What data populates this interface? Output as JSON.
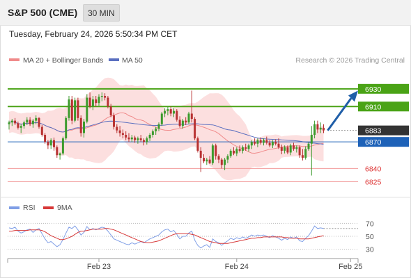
{
  "header": {
    "symbol": "S&P 500 (CME)",
    "interval": "30 MIN"
  },
  "datetime": "Tuesday, February 24, 2026 5:50:34 PM CET",
  "colors": {
    "up": "#3c9b2d",
    "down": "#b83232",
    "ma20": "#f08a8a",
    "ma50": "#5a6fc0",
    "bands": "#fcd9d9",
    "resistance": "#4aa316",
    "pivot": "#1e62b8",
    "support": "#f29b9b",
    "last": "#333333",
    "rsi": "#7f9ee6",
    "rsi_ma": "#d73838",
    "arrow": "#1f5ea8"
  },
  "chart_data": [
    {
      "type": "candlestick",
      "legend": [
        {
          "name": "MA 20 + Bollinger Bands",
          "color": "#f08a8a"
        },
        {
          "name": "MA 50",
          "color": "#5a6fc0"
        }
      ],
      "credit": "Research © 2026 Trading Central",
      "xlabels": [
        {
          "label": "Feb 23",
          "i": 30
        },
        {
          "label": "Feb 24",
          "i": 76
        },
        {
          "label": "Feb 25",
          "i": 114
        }
      ],
      "ylim": [
        6812,
        6944
      ],
      "levels": [
        {
          "label": "6930",
          "value": 6930,
          "kind": "resistance"
        },
        {
          "label": "6910",
          "value": 6910,
          "kind": "resistance"
        },
        {
          "label": "6883",
          "value": 6883,
          "kind": "last"
        },
        {
          "label": "6870",
          "value": 6870,
          "kind": "pivot"
        },
        {
          "label": "6840",
          "value": 6840,
          "kind": "support"
        },
        {
          "label": "6825",
          "value": 6825,
          "kind": "support"
        }
      ],
      "forecast": {
        "from": 6883,
        "to": 6928
      },
      "ohlc": [
        [
          6890,
          6894,
          6884,
          6892
        ],
        [
          6892,
          6896,
          6888,
          6894
        ],
        [
          6894,
          6897,
          6889,
          6891
        ],
        [
          6891,
          6893,
          6884,
          6886
        ],
        [
          6886,
          6890,
          6880,
          6888
        ],
        [
          6888,
          6894,
          6885,
          6892
        ],
        [
          6892,
          6898,
          6889,
          6895
        ],
        [
          6895,
          6898,
          6888,
          6890
        ],
        [
          6890,
          6896,
          6886,
          6894
        ],
        [
          6894,
          6900,
          6890,
          6897
        ],
        [
          6897,
          6898,
          6885,
          6887
        ],
        [
          6887,
          6889,
          6876,
          6878
        ],
        [
          6878,
          6880,
          6868,
          6870
        ],
        [
          6870,
          6872,
          6862,
          6866
        ],
        [
          6866,
          6874,
          6862,
          6872
        ],
        [
          6872,
          6875,
          6860,
          6864
        ],
        [
          6864,
          6866,
          6852,
          6855
        ],
        [
          6855,
          6858,
          6850,
          6857
        ],
        [
          6857,
          6876,
          6855,
          6874
        ],
        [
          6874,
          6899,
          6872,
          6897
        ],
        [
          6897,
          6922,
          6894,
          6918
        ],
        [
          6918,
          6922,
          6890,
          6894
        ],
        [
          6894,
          6920,
          6892,
          6917
        ],
        [
          6917,
          6920,
          6894,
          6897
        ],
        [
          6897,
          6900,
          6876,
          6880
        ],
        [
          6880,
          6896,
          6875,
          6893
        ],
        [
          6893,
          6924,
          6891,
          6920
        ],
        [
          6920,
          6926,
          6908,
          6910
        ],
        [
          6910,
          6922,
          6906,
          6918
        ],
        [
          6918,
          6922,
          6910,
          6914
        ],
        [
          6914,
          6924,
          6911,
          6921
        ],
        [
          6921,
          6926,
          6916,
          6922
        ],
        [
          6922,
          6925,
          6917,
          6920
        ],
        [
          6920,
          6922,
          6908,
          6910
        ],
        [
          6910,
          6913,
          6898,
          6900
        ],
        [
          6900,
          6903,
          6884,
          6887
        ],
        [
          6887,
          6890,
          6880,
          6883
        ],
        [
          6883,
          6888,
          6876,
          6880
        ],
        [
          6880,
          6884,
          6874,
          6878
        ],
        [
          6878,
          6882,
          6872,
          6875
        ],
        [
          6875,
          6880,
          6870,
          6873
        ],
        [
          6873,
          6878,
          6870,
          6875
        ],
        [
          6875,
          6877,
          6869,
          6872
        ],
        [
          6872,
          6876,
          6868,
          6874
        ],
        [
          6874,
          6878,
          6870,
          6872
        ],
        [
          6872,
          6874,
          6866,
          6870
        ],
        [
          6870,
          6876,
          6867,
          6874
        ],
        [
          6874,
          6880,
          6871,
          6878
        ],
        [
          6878,
          6884,
          6875,
          6882
        ],
        [
          6882,
          6887,
          6878,
          6885
        ],
        [
          6885,
          6892,
          6882,
          6890
        ],
        [
          6890,
          6904,
          6888,
          6902
        ],
        [
          6902,
          6908,
          6898,
          6905
        ],
        [
          6905,
          6910,
          6900,
          6907
        ],
        [
          6907,
          6910,
          6899,
          6902
        ],
        [
          6902,
          6908,
          6898,
          6905
        ],
        [
          6905,
          6907,
          6893,
          6895
        ],
        [
          6895,
          6899,
          6886,
          6888
        ],
        [
          6888,
          6896,
          6885,
          6894
        ],
        [
          6894,
          6898,
          6889,
          6892
        ],
        [
          6892,
          6904,
          6890,
          6902
        ],
        [
          6902,
          6928,
          6892,
          6896
        ],
        [
          6896,
          6898,
          6872,
          6874
        ],
        [
          6874,
          6876,
          6858,
          6860
        ],
        [
          6860,
          6864,
          6836,
          6852
        ],
        [
          6852,
          6856,
          6846,
          6848
        ],
        [
          6848,
          6852,
          6844,
          6850
        ],
        [
          6850,
          6854,
          6845,
          6846
        ],
        [
          6846,
          6868,
          6844,
          6866
        ],
        [
          6866,
          6868,
          6850,
          6854
        ],
        [
          6854,
          6856,
          6846,
          6850
        ],
        [
          6850,
          6852,
          6840,
          6844
        ],
        [
          6844,
          6852,
          6838,
          6850
        ],
        [
          6850,
          6856,
          6846,
          6854
        ],
        [
          6854,
          6862,
          6852,
          6860
        ],
        [
          6860,
          6864,
          6855,
          6857
        ],
        [
          6857,
          6864,
          6854,
          6862
        ],
        [
          6862,
          6866,
          6858,
          6860
        ],
        [
          6860,
          6866,
          6857,
          6864
        ],
        [
          6864,
          6868,
          6860,
          6862
        ],
        [
          6862,
          6868,
          6859,
          6866
        ],
        [
          6866,
          6872,
          6862,
          6870
        ],
        [
          6870,
          6874,
          6866,
          6868
        ],
        [
          6868,
          6874,
          6864,
          6872
        ],
        [
          6872,
          6875,
          6867,
          6869
        ],
        [
          6869,
          6874,
          6866,
          6872
        ],
        [
          6872,
          6876,
          6867,
          6869
        ],
        [
          6869,
          6872,
          6864,
          6866
        ],
        [
          6866,
          6872,
          6863,
          6870
        ],
        [
          6870,
          6873,
          6866,
          6868
        ],
        [
          6868,
          6874,
          6862,
          6864
        ],
        [
          6864,
          6867,
          6856,
          6860
        ],
        [
          6860,
          6866,
          6857,
          6864
        ],
        [
          6864,
          6866,
          6856,
          6858
        ],
        [
          6858,
          6868,
          6855,
          6866
        ],
        [
          6866,
          6869,
          6860,
          6862
        ],
        [
          6862,
          6866,
          6858,
          6864
        ],
        [
          6864,
          6866,
          6852,
          6855
        ],
        [
          6855,
          6862,
          6849,
          6852
        ],
        [
          6852,
          6865,
          6850,
          6862
        ],
        [
          6862,
          6870,
          6860,
          6868
        ],
        [
          6868,
          6888,
          6832,
          6878
        ],
        [
          6878,
          6894,
          6874,
          6890
        ],
        [
          6890,
          6894,
          6880,
          6884
        ],
        [
          6884,
          6892,
          6880,
          6886
        ],
        [
          6886,
          6890,
          6880,
          6883
        ]
      ]
    },
    {
      "type": "line",
      "title": "",
      "legend": [
        {
          "name": "RSI",
          "color": "#7f9ee6"
        },
        {
          "name": "9MA",
          "color": "#d73838"
        }
      ],
      "yticks": [
        30,
        50,
        70
      ],
      "ylim": [
        20,
        80
      ],
      "series": [
        {
          "name": "RSI",
          "values": [
            63,
            62,
            64,
            58,
            55,
            57,
            60,
            61,
            56,
            60,
            62,
            54,
            46,
            40,
            42,
            38,
            34,
            37,
            45,
            55,
            64,
            62,
            66,
            60,
            52,
            56,
            65,
            60,
            62,
            60,
            62,
            64,
            63,
            58,
            52,
            46,
            44,
            42,
            40,
            38,
            37,
            40,
            38,
            40,
            42,
            40,
            43,
            46,
            48,
            50,
            52,
            57,
            60,
            61,
            57,
            59,
            53,
            46,
            50,
            50,
            55,
            58,
            44,
            36,
            32,
            35,
            37,
            33,
            46,
            42,
            40,
            36,
            40,
            43,
            47,
            45,
            48,
            46,
            49,
            47,
            49,
            52,
            50,
            52,
            51,
            52,
            50,
            48,
            51,
            49,
            47,
            44,
            47,
            45,
            49,
            47,
            49,
            43,
            42,
            47,
            51,
            58,
            66,
            62,
            63,
            62
          ]
        },
        {
          "name": "9MA",
          "values": [
            58,
            58,
            59,
            59,
            59,
            59,
            59,
            60,
            60,
            60,
            60,
            59,
            57,
            54,
            51,
            49,
            47,
            45,
            45,
            46,
            48,
            50,
            53,
            56,
            58,
            58,
            59,
            60,
            61,
            61,
            61,
            61,
            62,
            62,
            61,
            60,
            58,
            56,
            54,
            52,
            50,
            48,
            46,
            44,
            42,
            41,
            40,
            40,
            41,
            42,
            43,
            45,
            47,
            49,
            51,
            53,
            54,
            54,
            54,
            54,
            54,
            53,
            52,
            50,
            48,
            46,
            44,
            42,
            41,
            40,
            39,
            39,
            39,
            39,
            40,
            41,
            42,
            43,
            44,
            45,
            46,
            47,
            47,
            48,
            48,
            49,
            49,
            49,
            49,
            49,
            49,
            49,
            48,
            48,
            47,
            47,
            47,
            46,
            46,
            46,
            46,
            47,
            48,
            49,
            50,
            51
          ]
        }
      ]
    }
  ]
}
